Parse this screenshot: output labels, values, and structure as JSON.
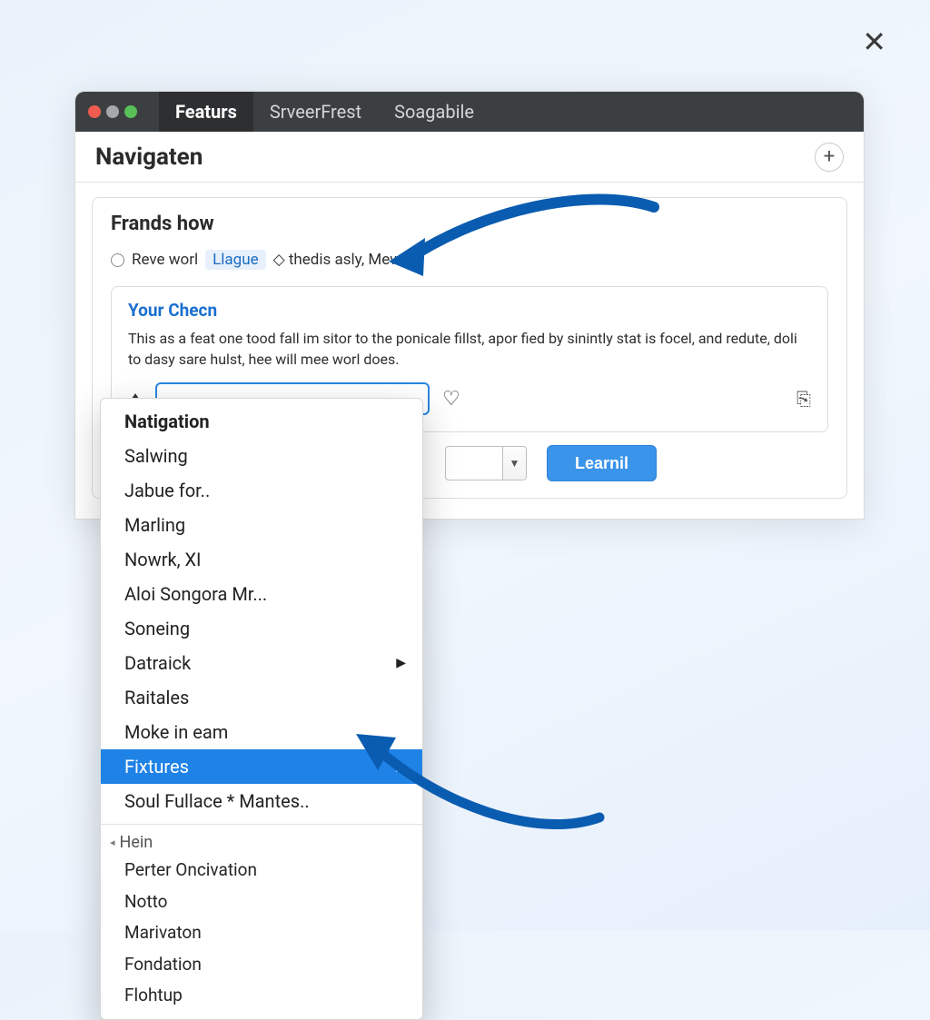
{
  "close_icon": "✕",
  "titlebar": {
    "tabs": [
      "Featurs",
      "SrveerFrest",
      "Soagabile"
    ],
    "active_tab_index": 0
  },
  "header": {
    "title": "Navigaten",
    "plus_label": "+"
  },
  "card": {
    "title": "Frands how",
    "radio_text_before": "Reve worl",
    "radio_chip": "Llague",
    "radio_text_after": "◇ thedis asly, Mew:.",
    "inner": {
      "heading": "Your Checn",
      "body": "This as a feat one tood fall im sitor to the ponicale fillst, apor fied by sinintly stat is focel, and redute, doli to dasy sare hulst, hee will mee worl does."
    },
    "button_label": "Learnil"
  },
  "menu": {
    "items": [
      {
        "label": "Natigation",
        "submenu": false
      },
      {
        "label": "Salwing",
        "submenu": false
      },
      {
        "label": "Jabue for..",
        "submenu": false
      },
      {
        "label": "Marling",
        "submenu": false
      },
      {
        "label": "Nowrk, XI",
        "submenu": false
      },
      {
        "label": "Aloi Songora Mr...",
        "submenu": false
      },
      {
        "label": "Soneing",
        "submenu": false
      },
      {
        "label": "Datraick",
        "submenu": true
      },
      {
        "label": "Raitales",
        "submenu": false
      },
      {
        "label": "Moke in eam",
        "submenu": false
      },
      {
        "label": "Fixtures",
        "submenu": true,
        "selected": true
      },
      {
        "label": "Soul Fullace * Mantes..",
        "submenu": false
      }
    ],
    "group_label": "Hein",
    "sub_items": [
      "Perter Oncivation",
      "Notto",
      "Marivaton",
      "Fondation",
      "Flohtup"
    ]
  }
}
